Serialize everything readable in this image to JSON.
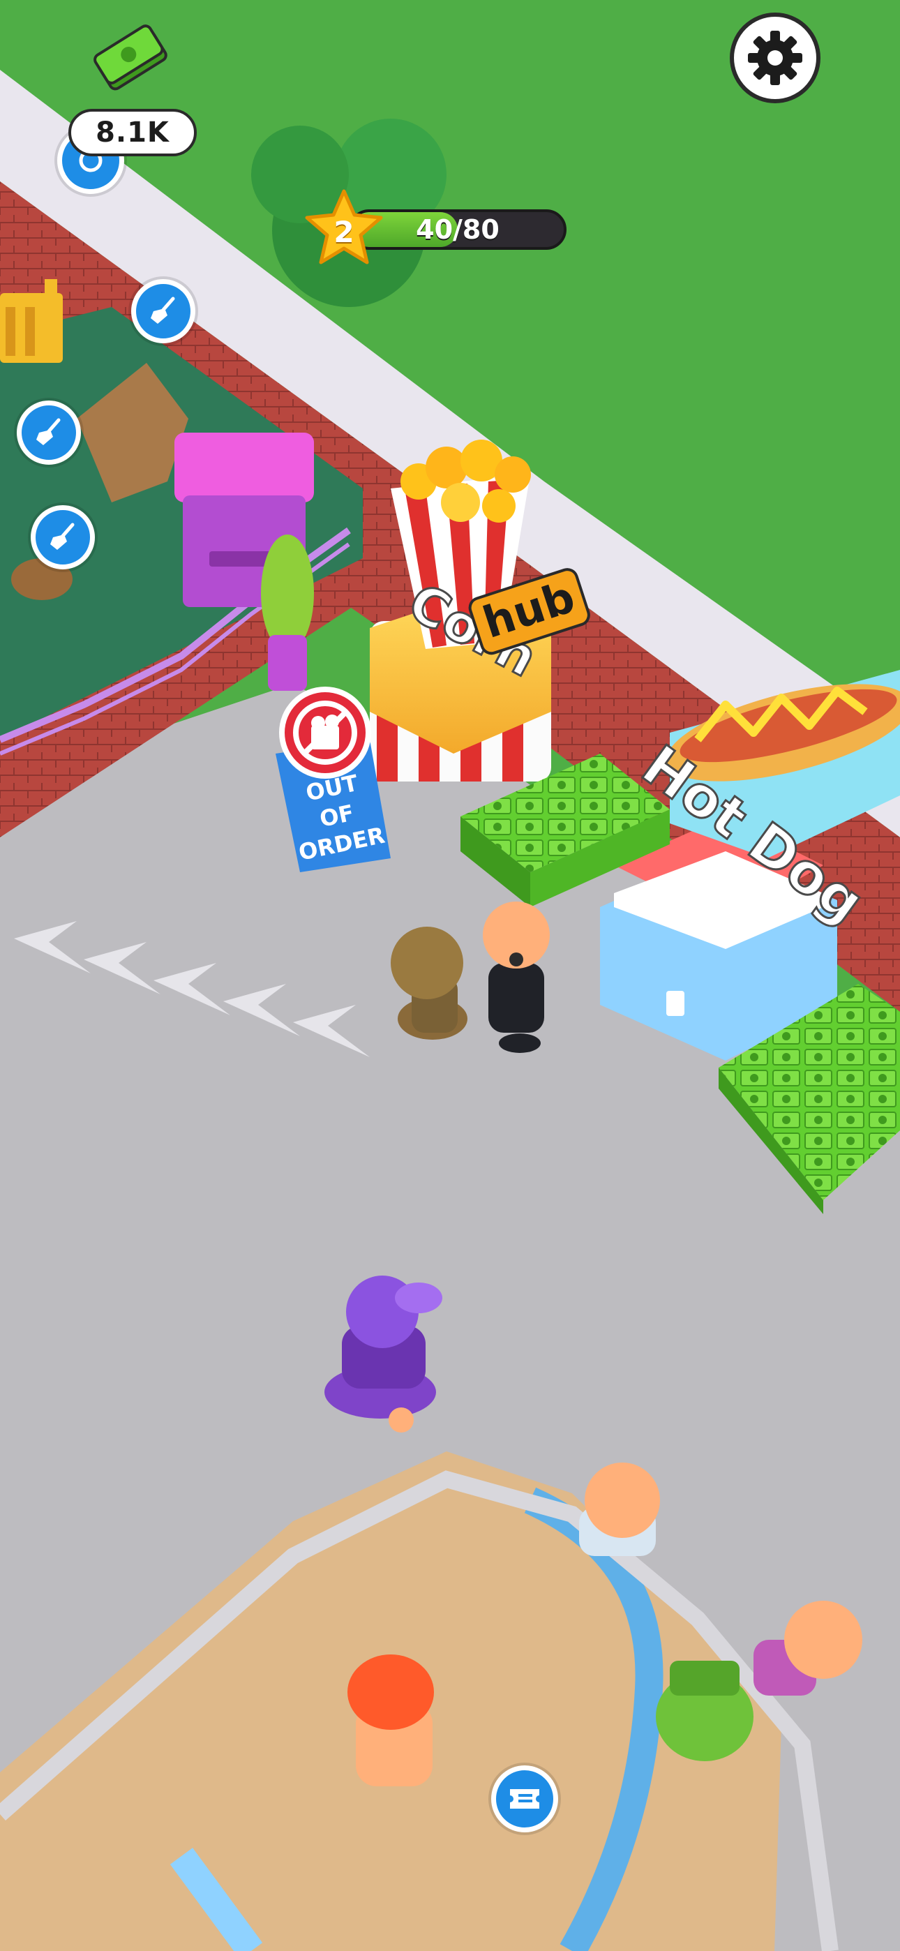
{
  "hud": {
    "cash": "8.1K",
    "cash_icon": "cash-stack-icon",
    "settings_icon": "gear-icon",
    "level": "2",
    "xp_current": "40",
    "xp_max": "80",
    "xp_progress": 0.5,
    "xp_text": "40/80"
  },
  "signs": {
    "corn_word": "Corn",
    "hub_word": "hub",
    "hotdog_word": "Hot Dog",
    "out_of_order_line1": "OUT",
    "out_of_order_line2": "OF",
    "out_of_order_line3": "ORDER"
  },
  "action_buttons": [
    {
      "name": "clean-button-1",
      "icon": "broom-icon"
    },
    {
      "name": "clean-button-2",
      "icon": "broom-icon"
    },
    {
      "name": "clean-button-3",
      "icon": "broom-icon"
    },
    {
      "name": "ticket-button",
      "icon": "ticket-icon"
    }
  ],
  "colors": {
    "grass": "#4fae46",
    "floor": "#bdbcc0",
    "brick": "#b8473f",
    "accent_blue": "#1e8de6",
    "cash_green": "#6fd93a",
    "xp_green": "#6cc235",
    "star_gold": "#ffc21a"
  }
}
